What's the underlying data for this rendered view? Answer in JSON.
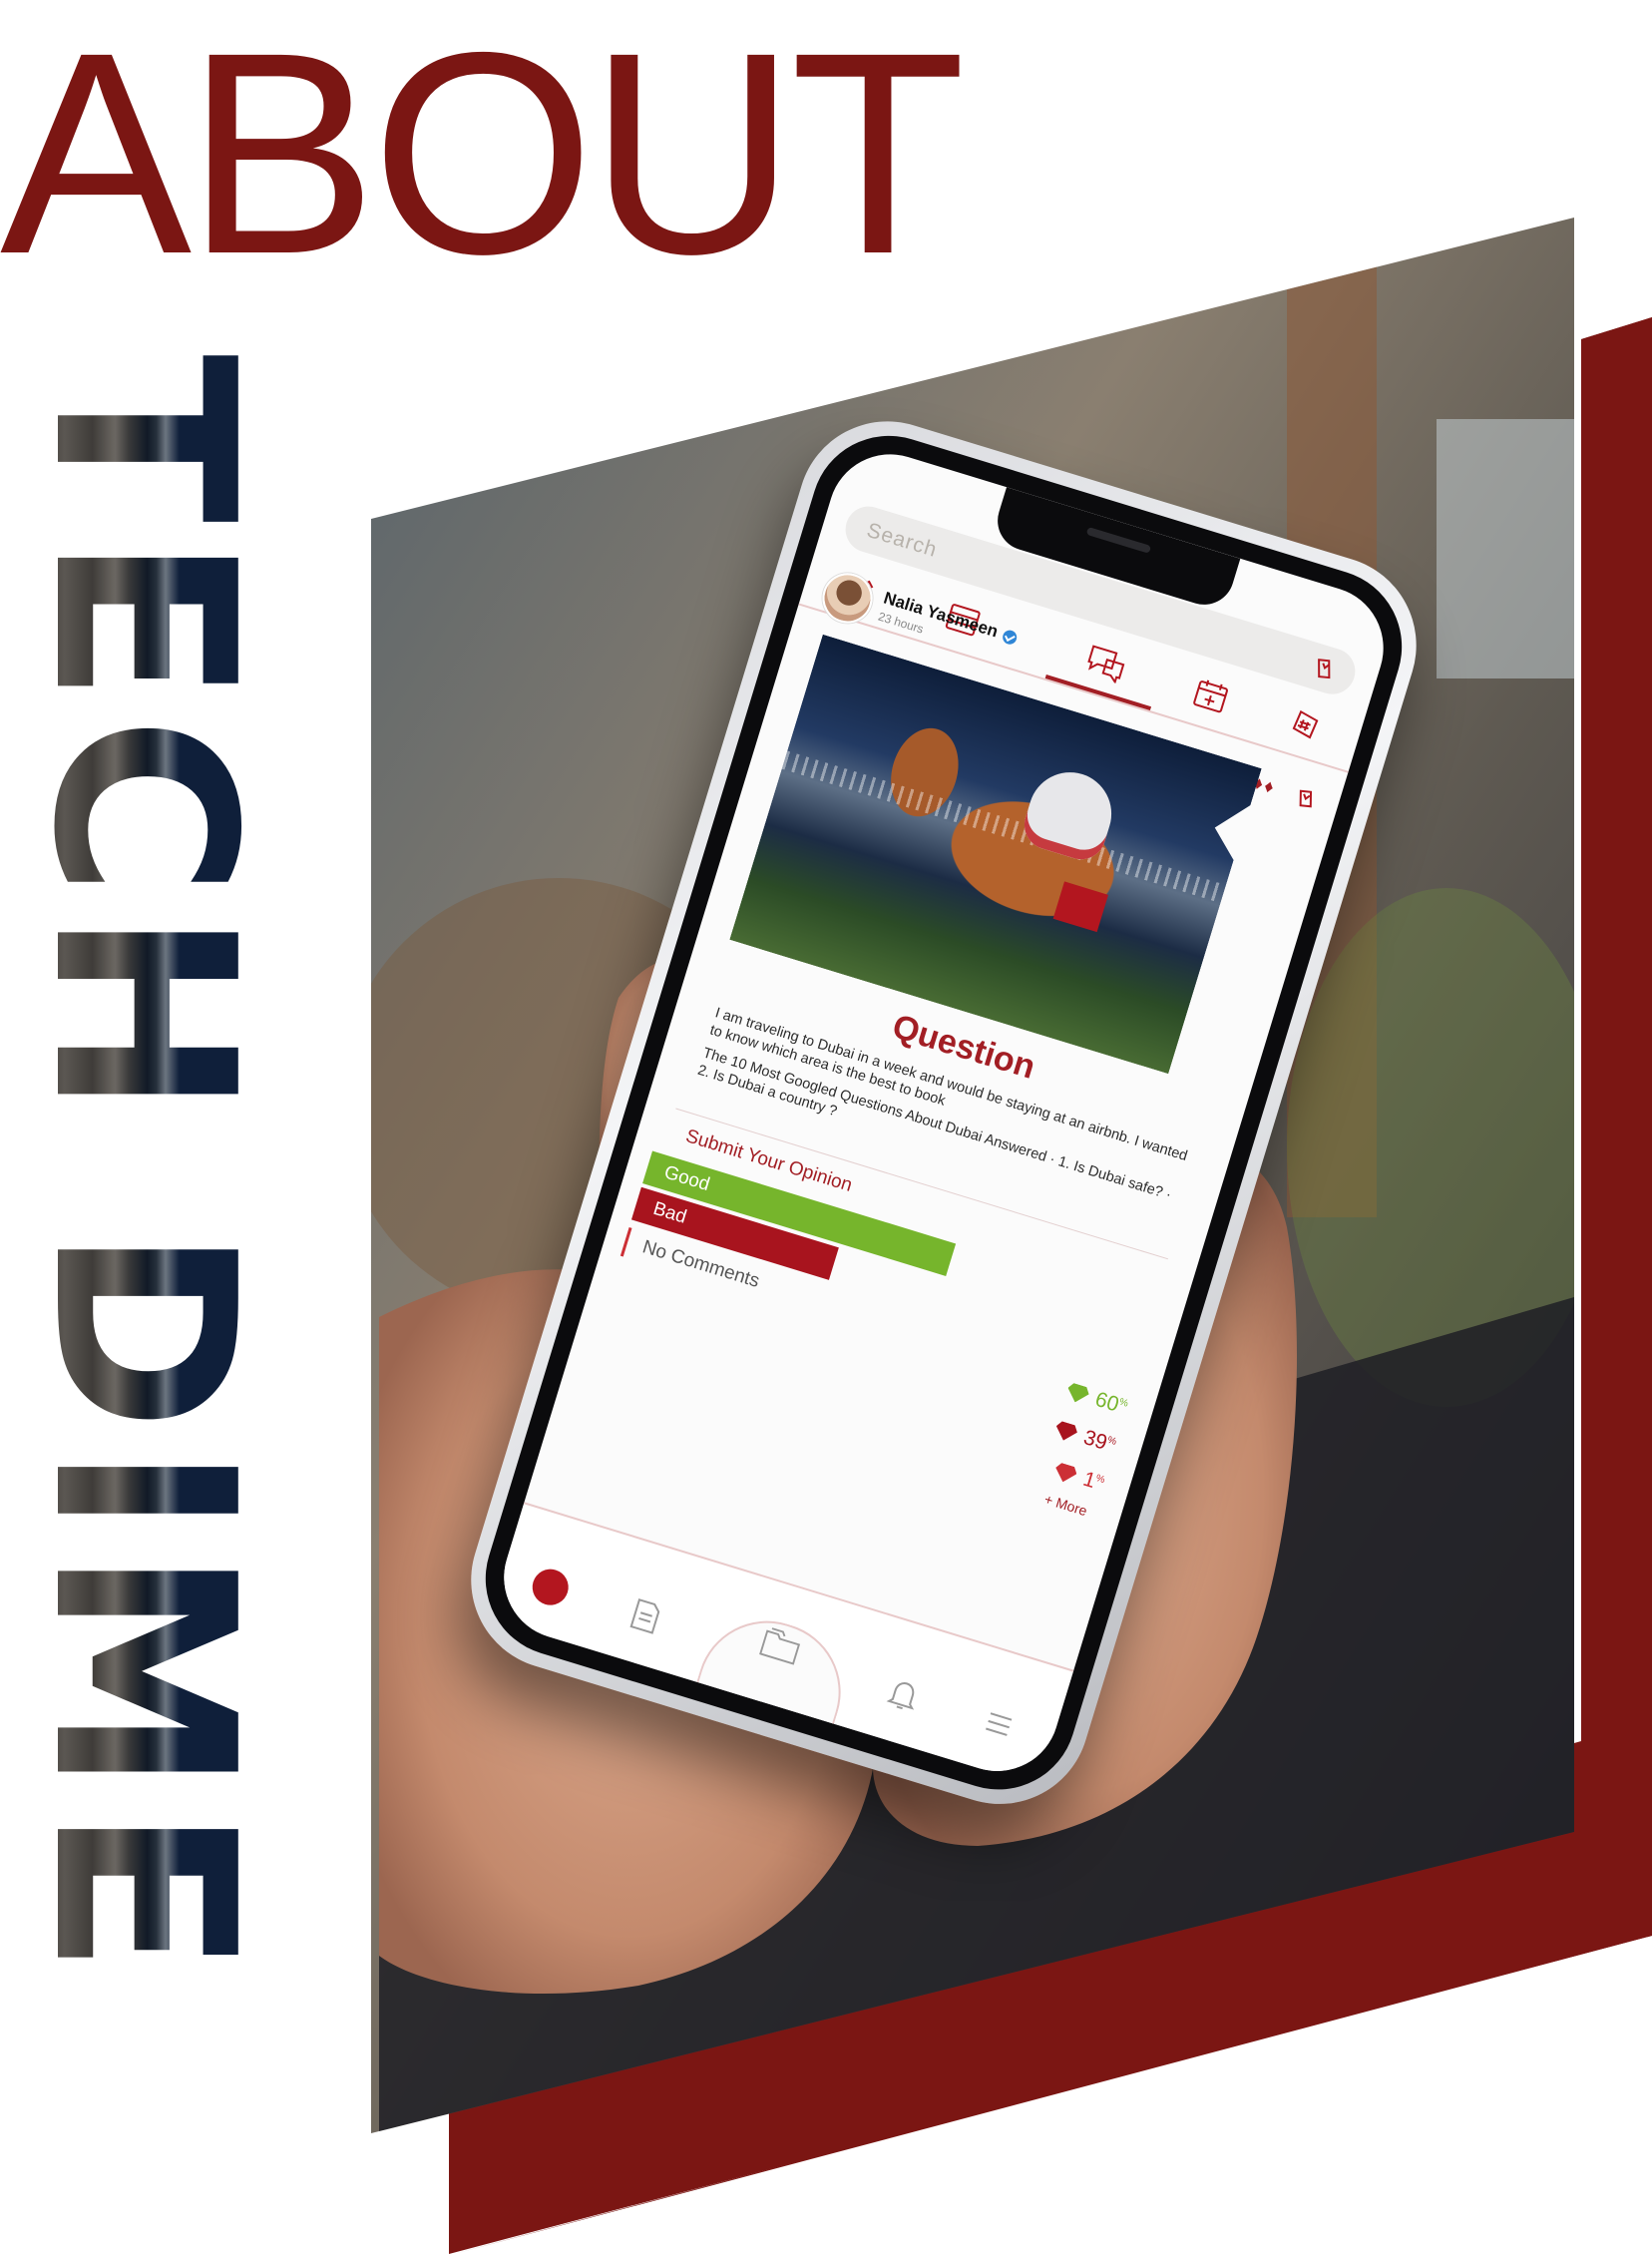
{
  "hero": {
    "title": "ABOUT",
    "vertical_title": "TECH DIME"
  },
  "colors": {
    "brand_red": "#7b1613",
    "accent_red": "#a21e24",
    "good_green": "#76b52c",
    "bad_red": "#a8141e",
    "navy": "#0f1f3a"
  },
  "app": {
    "search": {
      "placeholder": "Search"
    },
    "tabs": [
      {
        "icon": "pen-icon"
      },
      {
        "icon": "list-icon"
      },
      {
        "icon": "chat-icon",
        "active": true
      },
      {
        "icon": "calendar-add-icon"
      },
      {
        "icon": "hashtag-icon"
      }
    ],
    "post": {
      "author": "Nalia Yasmeen",
      "time": "23 hours",
      "type_label": "Question",
      "body": [
        "I am traveling to Dubai in a week and would be staying at an airbnb. I wanted to know which area is the best to book",
        "The 10 Most Googled Questions About Dubai Answered · 1. Is Dubai safe? · 2. Is Dubai a country ?"
      ]
    },
    "opinion": {
      "title": "Submit Your Opinion",
      "options": [
        {
          "label": "Good",
          "percent": 60,
          "percent_label": "60",
          "color": "#76b52c"
        },
        {
          "label": "Bad",
          "percent": 39,
          "percent_label": "39",
          "color": "#a8141e"
        },
        {
          "label": "No Comments",
          "percent": 1,
          "percent_label": "1",
          "color": "#cc2f35"
        }
      ],
      "percent_sign": "%",
      "more_label": "+ More"
    },
    "bottom_nav": [
      "globe-icon",
      "document-icon",
      "folders-icon",
      "bell-icon",
      "menu-icon"
    ]
  }
}
